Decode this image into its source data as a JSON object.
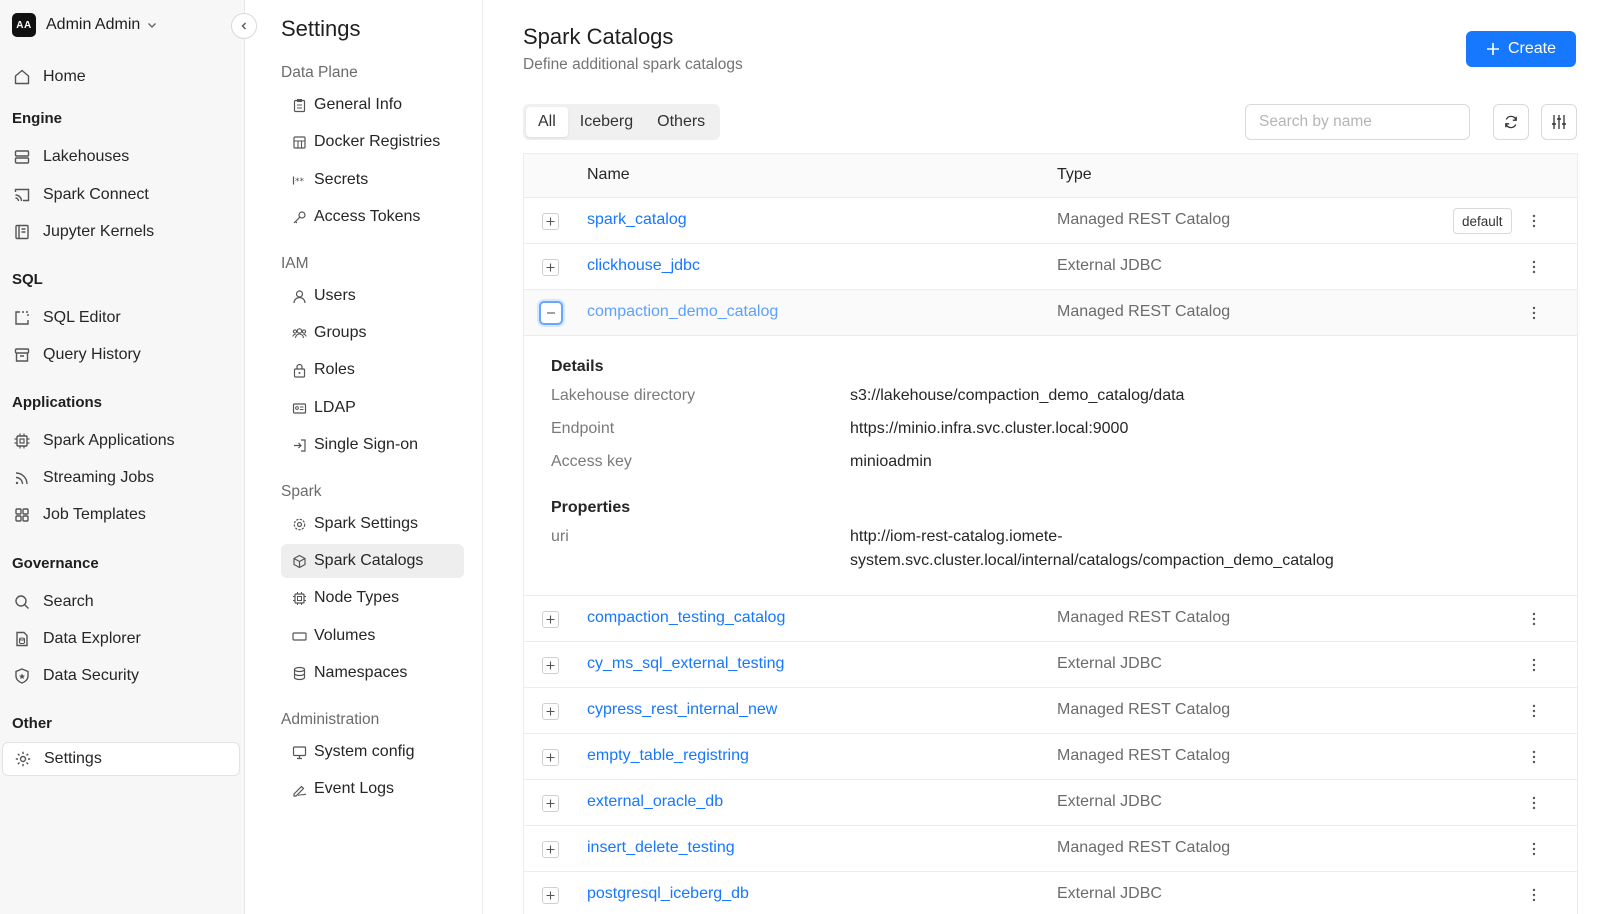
{
  "user": {
    "initials": "AA",
    "name": "Admin Admin"
  },
  "nav": {
    "home": "Home",
    "sections": {
      "engine": "Engine",
      "sql": "SQL",
      "applications": "Applications",
      "governance": "Governance",
      "other": "Other"
    },
    "items": {
      "lakehouses": "Lakehouses",
      "spark_connect": "Spark Connect",
      "jupyter_kernels": "Jupyter Kernels",
      "sql_editor": "SQL Editor",
      "query_history": "Query History",
      "spark_applications": "Spark Applications",
      "streaming_jobs": "Streaming Jobs",
      "job_templates": "Job Templates",
      "search": "Search",
      "data_explorer": "Data Explorer",
      "data_security": "Data Security",
      "settings": "Settings"
    }
  },
  "settings": {
    "title": "Settings",
    "sections": {
      "data_plane": "Data Plane",
      "iam": "IAM",
      "spark": "Spark",
      "administration": "Administration"
    },
    "items": {
      "general_info": "General Info",
      "docker_registries": "Docker Registries",
      "secrets": "Secrets",
      "access_tokens": "Access Tokens",
      "users": "Users",
      "groups": "Groups",
      "roles": "Roles",
      "ldap": "LDAP",
      "single_sign_on": "Single Sign-on",
      "spark_settings": "Spark Settings",
      "spark_catalogs": "Spark Catalogs",
      "node_types": "Node Types",
      "volumes": "Volumes",
      "namespaces": "Namespaces",
      "system_config": "System config",
      "event_logs": "Event Logs"
    }
  },
  "page": {
    "title": "Spark Catalogs",
    "subtitle": "Define additional spark catalogs",
    "create_label": "Create",
    "tabs": {
      "all": "All",
      "iceberg": "Iceberg",
      "others": "Others"
    },
    "search_placeholder": "Search by name"
  },
  "table": {
    "headers": {
      "name": "Name",
      "type": "Type"
    },
    "default_badge": "default",
    "rows": [
      {
        "name": "spark_catalog",
        "type": "Managed REST Catalog"
      },
      {
        "name": "clickhouse_jdbc",
        "type": "External JDBC"
      },
      {
        "name": "compaction_demo_catalog",
        "type": "Managed REST Catalog"
      },
      {
        "name": "compaction_testing_catalog",
        "type": "Managed REST Catalog"
      },
      {
        "name": "cy_ms_sql_external_testing",
        "type": "External JDBC"
      },
      {
        "name": "cypress_rest_internal_new",
        "type": "Managed REST Catalog"
      },
      {
        "name": "empty_table_registring",
        "type": "Managed REST Catalog"
      },
      {
        "name": "external_oracle_db",
        "type": "External JDBC"
      },
      {
        "name": "insert_delete_testing",
        "type": "Managed REST Catalog"
      },
      {
        "name": "postgresql_iceberg_db",
        "type": "External JDBC"
      }
    ],
    "details": {
      "details_heading": "Details",
      "lakehouse_directory_label": "Lakehouse directory",
      "lakehouse_directory_value": "s3://lakehouse/compaction_demo_catalog/data",
      "endpoint_label": "Endpoint",
      "endpoint_value": "https://minio.infra.svc.cluster.local:9000",
      "access_key_label": "Access key",
      "access_key_value": "minioadmin",
      "properties_heading": "Properties",
      "uri_label": "uri",
      "uri_value_line1": "http://iom-rest-catalog.iomete-",
      "uri_value_line2": "system.svc.cluster.local/internal/catalogs/compaction_demo_catalog"
    }
  },
  "colors": {
    "accent": "#1677ff",
    "nav_bg": "#f7f7f7",
    "active_item_bg": "#eeeeee"
  }
}
